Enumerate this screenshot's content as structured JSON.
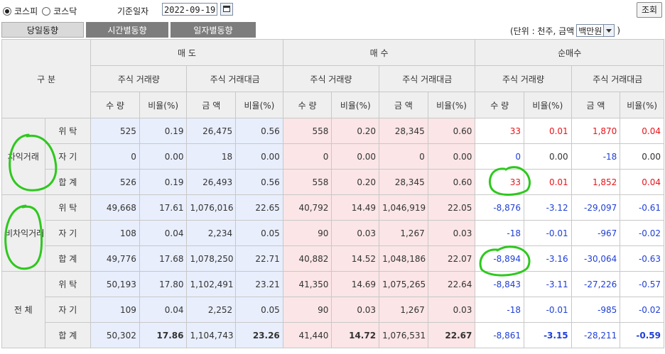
{
  "toolbar": {
    "market_options": [
      "코스피",
      "코스닥"
    ],
    "selected_market": "코스피",
    "date_label": "기준일자",
    "date_value": "2022-09-19",
    "lookup_label": "조회"
  },
  "tabs": [
    "당일동향",
    "시간별동향",
    "일자별동향"
  ],
  "active_tab": "당일동향",
  "unit": {
    "prefix": "(단위 : 천주, 금액",
    "selected": "백만원",
    "suffix": ")"
  },
  "table": {
    "corner_label": "구 분",
    "groups": [
      "매 도",
      "매 수",
      "순매수"
    ],
    "subgroups": [
      "주식 거래량",
      "주식 거래대금",
      "주식 거래량",
      "주식 거래대금",
      "주식 거래량",
      "주식 거래대금"
    ],
    "columns": [
      "수 량",
      "비율(%)",
      "금 액",
      "비율(%)",
      "수 량",
      "비율(%)",
      "금 액",
      "비율(%)",
      "수 량",
      "비율(%)",
      "금 액",
      "비율(%)"
    ],
    "sections": [
      {
        "name": "차익거래",
        "rows": [
          {
            "label": "위 탁",
            "values": [
              "525",
              "0.19",
              "26,475",
              "0.56",
              "558",
              "0.20",
              "28,345",
              "0.60",
              "33",
              "0.01",
              "1,870",
              "0.04"
            ]
          },
          {
            "label": "자 기",
            "values": [
              "0",
              "0.00",
              "18",
              "0.00",
              "0",
              "0.00",
              "0",
              "0.00",
              "0",
              "0.00",
              "-18",
              "0.00"
            ]
          },
          {
            "label": "합 계",
            "values": [
              "526",
              "0.19",
              "26,493",
              "0.56",
              "558",
              "0.20",
              "28,345",
              "0.60",
              "33",
              "0.01",
              "1,852",
              "0.04"
            ]
          }
        ]
      },
      {
        "name": "비차익거래",
        "rows": [
          {
            "label": "위 탁",
            "values": [
              "49,668",
              "17.61",
              "1,076,016",
              "22.65",
              "40,792",
              "14.49",
              "1,046,919",
              "22.05",
              "-8,876",
              "-3.12",
              "-29,097",
              "-0.61"
            ]
          },
          {
            "label": "자 기",
            "values": [
              "108",
              "0.04",
              "2,234",
              "0.05",
              "90",
              "0.03",
              "1,267",
              "0.03",
              "-18",
              "-0.01",
              "-967",
              "-0.02"
            ]
          },
          {
            "label": "합 계",
            "values": [
              "49,776",
              "17.68",
              "1,078,250",
              "22.71",
              "40,882",
              "14.52",
              "1,048,186",
              "22.07",
              "-8,894",
              "-3.16",
              "-30,064",
              "-0.63"
            ]
          }
        ]
      },
      {
        "name": "전 체",
        "rows": [
          {
            "label": "위 탁",
            "values": [
              "50,193",
              "17.80",
              "1,102,491",
              "23.21",
              "41,350",
              "14.69",
              "1,075,265",
              "22.64",
              "-8,843",
              "-3.11",
              "-27,226",
              "-0.57"
            ]
          },
          {
            "label": "자 기",
            "values": [
              "109",
              "0.04",
              "2,252",
              "0.05",
              "90",
              "0.03",
              "1,267",
              "0.03",
              "-18",
              "-0.01",
              "-985",
              "-0.02"
            ]
          },
          {
            "label": "합 계",
            "values": [
              "50,302",
              "17.86",
              "1,104,743",
              "23.26",
              "41,440",
              "14.72",
              "1,076,531",
              "22.67",
              "-8,861",
              "-3.15",
              "-28,211",
              "-0.59"
            ]
          }
        ]
      }
    ]
  },
  "colors": {
    "sell_bg": "#e8eefc",
    "buy_bg": "#fbe5e6",
    "positive": "#e8141a",
    "negative": "#1f3fd6",
    "annotation": "#2ec81e"
  }
}
